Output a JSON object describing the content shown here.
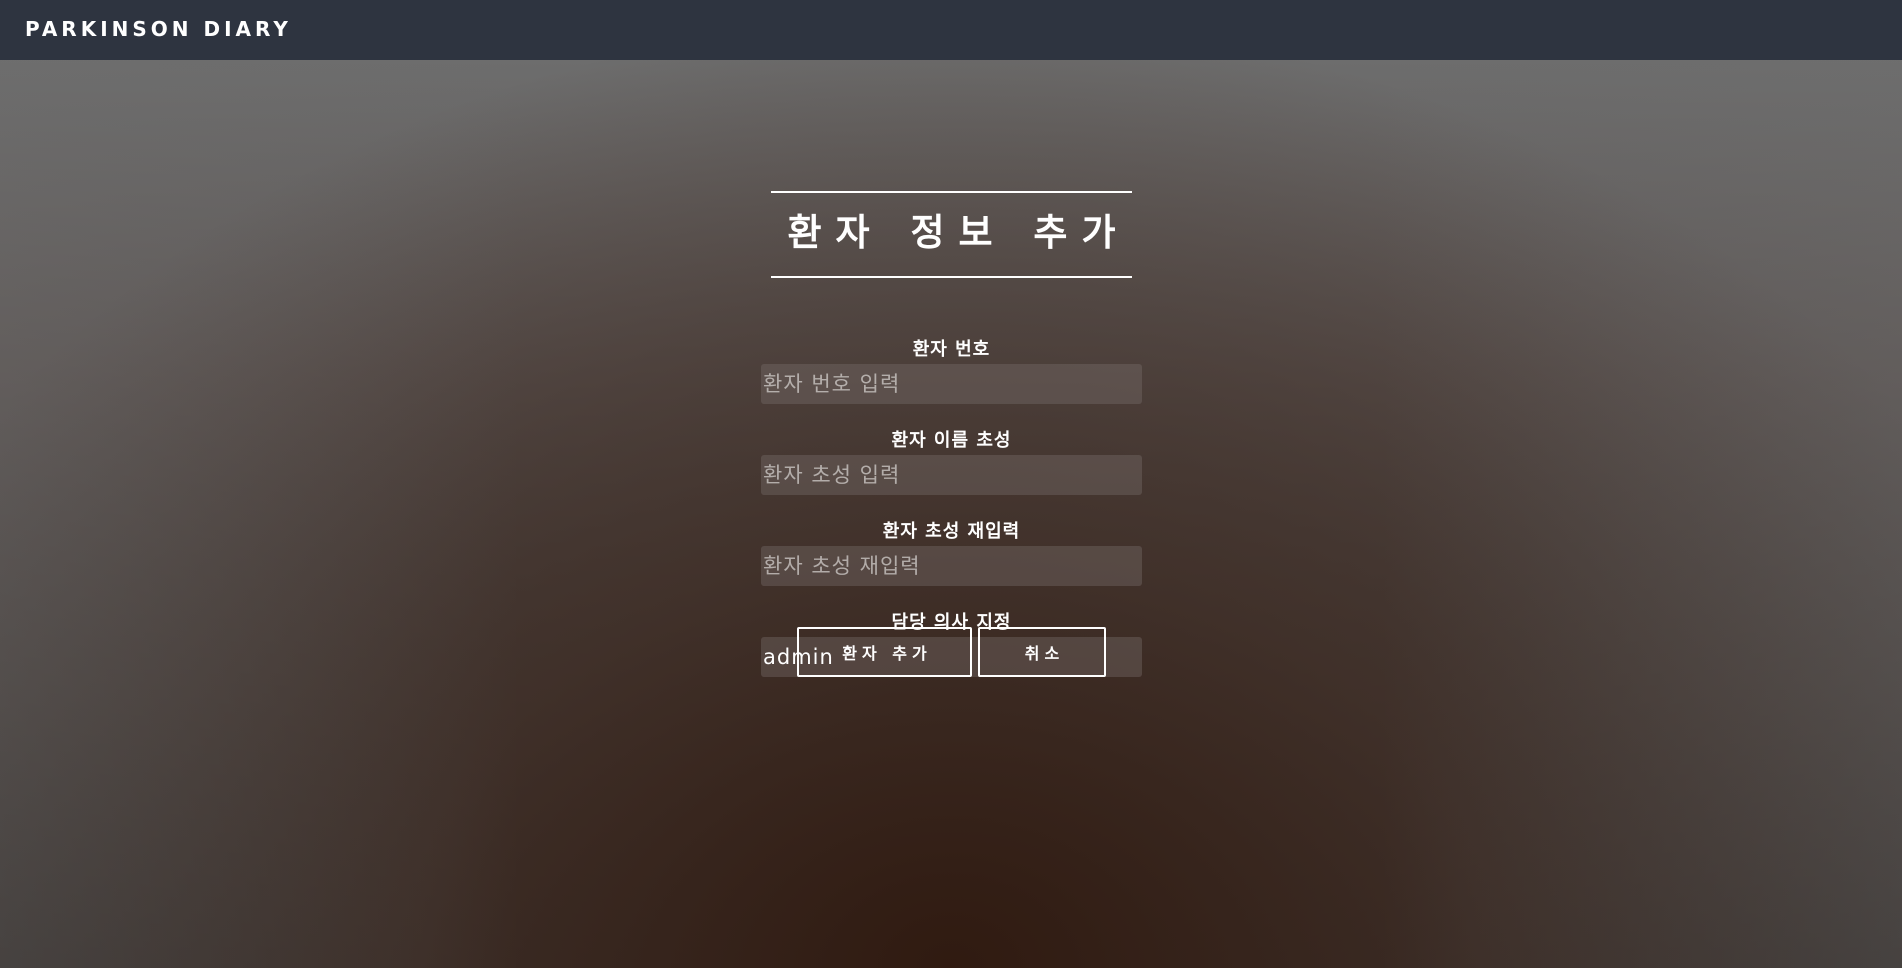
{
  "app": {
    "brand": "PARKINSON DIARY"
  },
  "form": {
    "title": "환자 정보 추가",
    "fields": [
      {
        "label": "환자 번호",
        "placeholder": "환자 번호 입력",
        "value": ""
      },
      {
        "label": "환자 이름 초성",
        "placeholder": "환자 초성 입력",
        "value": ""
      },
      {
        "label": "환자 초성 재입력",
        "placeholder": "환자 초성 재입력",
        "value": ""
      },
      {
        "label": "담당 의사 지정",
        "placeholder": "",
        "value": "admin"
      }
    ],
    "buttons": {
      "submit": "환자 추가",
      "cancel": "취소"
    }
  },
  "colors": {
    "topbar": "#2e3440",
    "text": "#ffffff"
  }
}
